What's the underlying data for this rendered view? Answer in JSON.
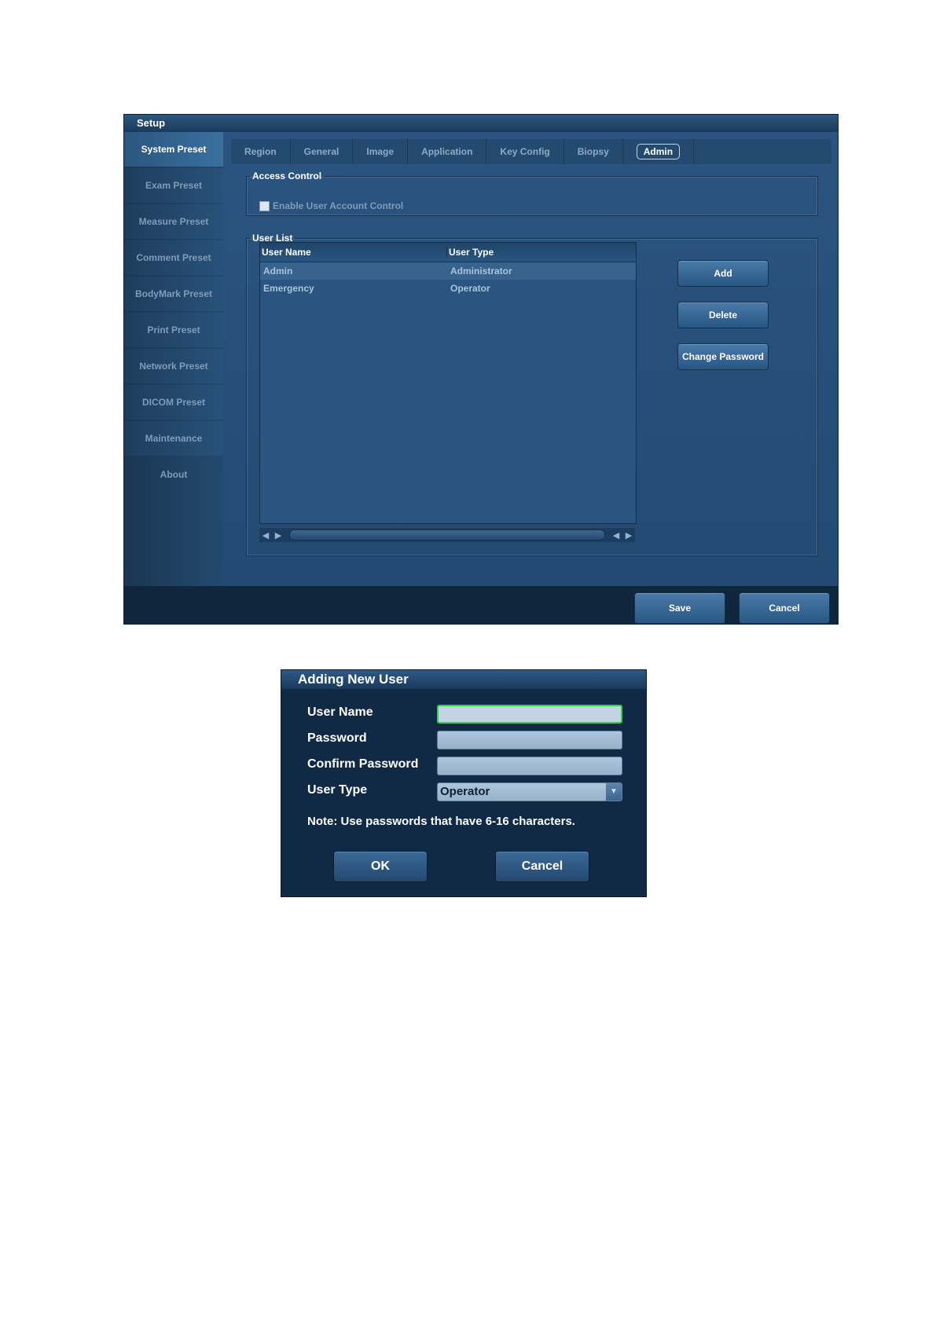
{
  "setup": {
    "title": "Setup",
    "sidebar": [
      {
        "label": "System Preset",
        "active": true
      },
      {
        "label": "Exam Preset"
      },
      {
        "label": "Measure Preset"
      },
      {
        "label": "Comment Preset"
      },
      {
        "label": "BodyMark Preset"
      },
      {
        "label": "Print Preset"
      },
      {
        "label": "Network Preset"
      },
      {
        "label": "DICOM Preset"
      },
      {
        "label": "Maintenance"
      },
      {
        "label": "About"
      }
    ],
    "tabs": [
      "Region",
      "General",
      "Image",
      "Application",
      "Key Config",
      "Biopsy",
      "Admin"
    ],
    "active_tab": "Admin",
    "access_control": {
      "legend": "Access Control",
      "checkbox_label": "Enable User Account Control",
      "checked": false
    },
    "user_list": {
      "legend": "User List",
      "columns": [
        "User Name",
        "User Type"
      ],
      "rows": [
        {
          "name": "Admin",
          "type": "Administrator"
        },
        {
          "name": "Emergency",
          "type": "Operator"
        }
      ]
    },
    "buttons": {
      "add": "Add",
      "delete": "Delete",
      "change_password": "Change Password"
    },
    "footer": {
      "save": "Save",
      "cancel": "Cancel"
    }
  },
  "dialog": {
    "title": "Adding New User",
    "fields": {
      "user_name": "User Name",
      "password": "Password",
      "confirm_password": "Confirm Password",
      "user_type": "User Type"
    },
    "user_type_value": "Operator",
    "note": "Note: Use passwords that have 6-16 characters.",
    "ok": "OK",
    "cancel": "Cancel"
  },
  "colors": {
    "window_bg": "#1f3e5f",
    "focus_border": "#2bd44a",
    "dialog_bg": "#102944"
  }
}
